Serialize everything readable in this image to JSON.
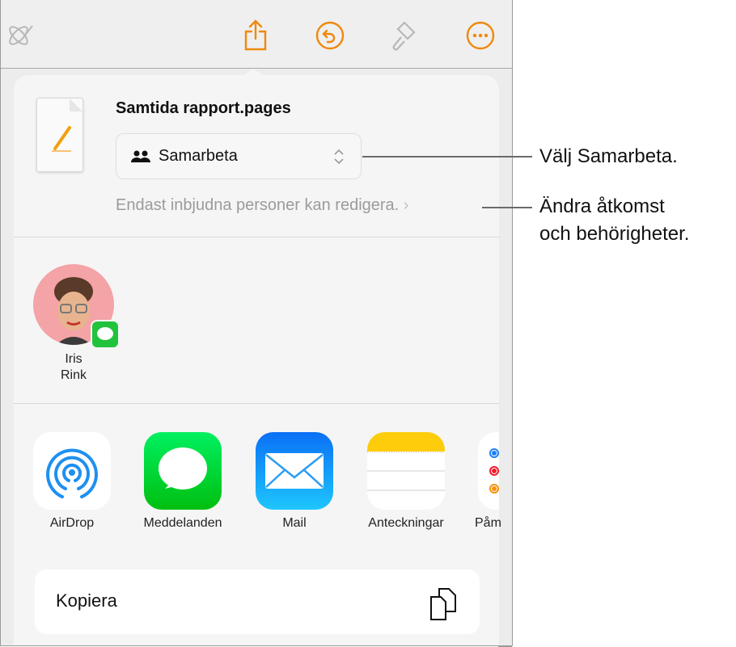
{
  "toolbar": {
    "icons": [
      "collaboration-icon",
      "share-icon",
      "undo-icon",
      "format-brush-icon",
      "more-icon"
    ],
    "accent": "#f0880a"
  },
  "share": {
    "document_title": "Samtida rapport.pages",
    "mode_select": {
      "value": "Samarbeta",
      "icon": "people-icon"
    },
    "permissions_text": "Endast inbjudna personer kan redigera.",
    "people": [
      {
        "name_line1": "Iris",
        "name_line2": "Rink",
        "badge": "messages-icon"
      }
    ],
    "apps": [
      {
        "label": "AirDrop"
      },
      {
        "label": "Meddelanden"
      },
      {
        "label": "Mail"
      },
      {
        "label": "Anteckningar"
      },
      {
        "label": "Påm"
      }
    ],
    "copy_label": "Kopiera"
  },
  "callouts": {
    "select": "Välj Samarbeta.",
    "perm_line1": "Ändra åtkomst",
    "perm_line2": "och behörigheter."
  }
}
